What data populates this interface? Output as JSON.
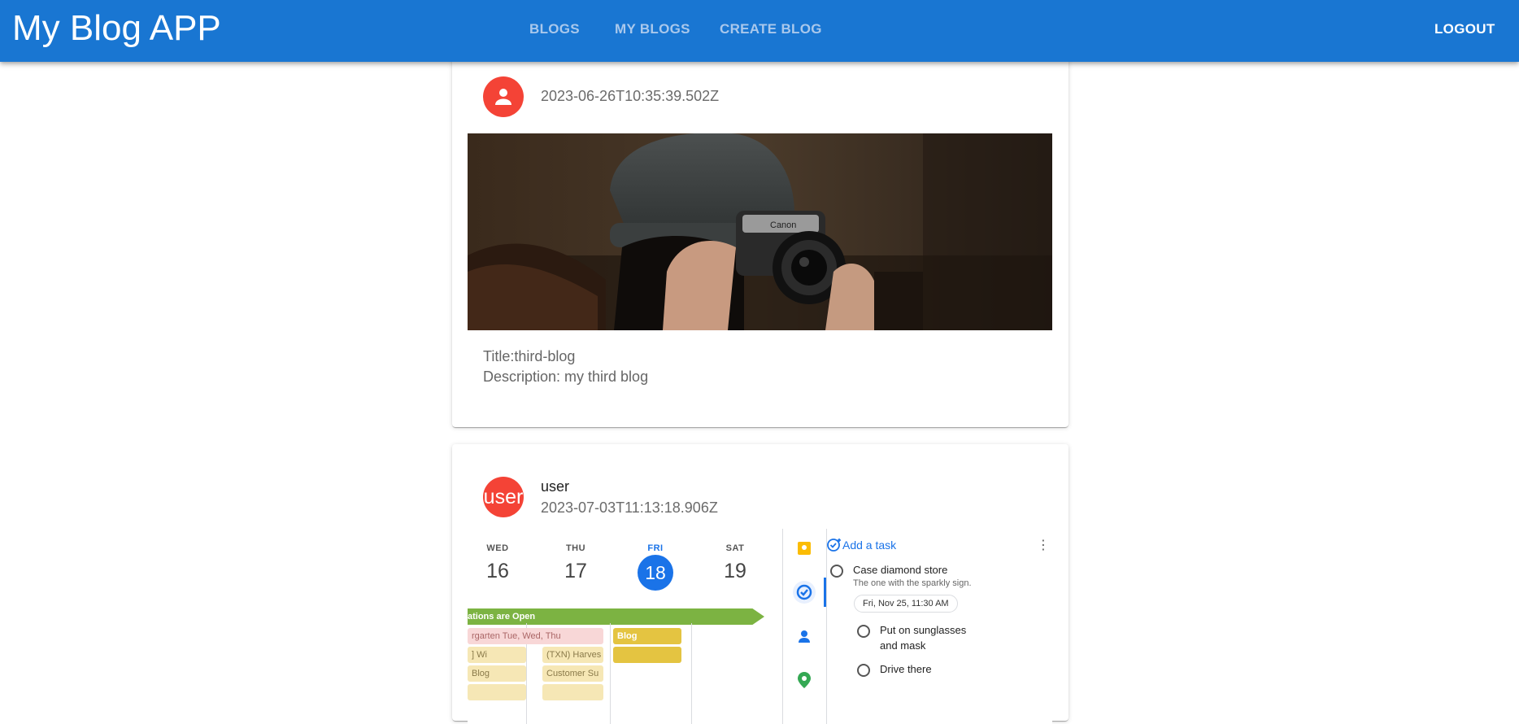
{
  "appbar": {
    "title": "My Blog APP",
    "nav": {
      "blogs": "BLOGS",
      "my_blogs": "MY BLOGS",
      "create_blog": "CREATE BLOG"
    },
    "logout": "LOGOUT"
  },
  "posts": [
    {
      "timestamp": "2023-06-26T10:35:39.502Z",
      "title": "Title:third-blog",
      "description": "Description: my third blog",
      "avatar_icon": "person-icon",
      "camera_brand": "Canon"
    },
    {
      "author": "user",
      "avatar_text": "user",
      "timestamp": "2023-07-03T11:13:18.906Z",
      "screenshot": {
        "days": [
          {
            "dow": "WED",
            "day": "16"
          },
          {
            "dow": "THU",
            "day": "17"
          },
          {
            "dow": "FRI",
            "day": "18"
          },
          {
            "dow": "SAT",
            "day": "19"
          }
        ],
        "banner": "ations are Open",
        "events": [
          "rgarten Tue, Wed, Thu",
          "Blog",
          "] Wi",
          "(TXN) Harves",
          "Blog",
          "Customer Su"
        ],
        "tasks": {
          "add": "Add a task",
          "items": [
            {
              "text": "Case diamond store",
              "sub": "The one with the sparkly sign.",
              "chip": "Fri, Nov 25, 11:30 AM"
            },
            {
              "text_line1": "Put on sunglasses",
              "text_line2": "and mask"
            },
            {
              "text": "Drive there"
            }
          ]
        }
      }
    }
  ],
  "colors": {
    "appbar": "#1976d2",
    "avatar": "#f44336",
    "calendar_accent": "#1a73e8"
  }
}
